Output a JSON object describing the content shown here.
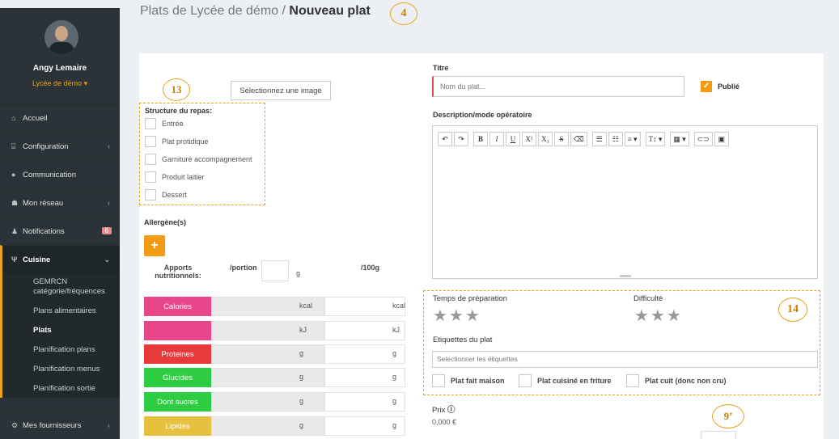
{
  "sidebar": {
    "user_name": "Angy Lemaire",
    "school": "Lycée de démo ▾",
    "items": [
      {
        "label": "Accueil",
        "icon": "home-icon",
        "glyph": "⌂"
      },
      {
        "label": "Configuration",
        "icon": "bank-icon",
        "glyph": "⌸",
        "chevron": "‹"
      },
      {
        "label": "Communication",
        "icon": "chat-icon",
        "glyph": "●"
      },
      {
        "label": "Mon réseau",
        "icon": "users-icon",
        "glyph": "☗",
        "chevron": "‹"
      },
      {
        "label": "Notifications",
        "icon": "bell-icon",
        "glyph": "♟",
        "badge": "6"
      },
      {
        "label": "Cuisine",
        "icon": "cutlery-icon",
        "glyph": "Ψ",
        "chevron": "⌄"
      }
    ],
    "sub_items": [
      "GEMRCN catégorie/fréquences",
      "Plans alimentaires",
      "Plats",
      "Planification plans",
      "Planification menus",
      "Planification sortie"
    ],
    "bottom_item": {
      "label": "Mes fournisseurs",
      "icon": "truck-icon",
      "glyph": "⚙",
      "chevron": "‹"
    }
  },
  "header": {
    "breadcrumb": "Plats de Lycée de démo / ",
    "title": "Nouveau plat"
  },
  "callouts": {
    "c4": "4",
    "c13": "13",
    "c14": "14",
    "c9": "9’"
  },
  "image_button": "Sélectionnez une image",
  "structure": {
    "title": "Structure du repas:",
    "options": [
      "Entrée",
      "Plat protidique",
      "Garniture accompagnement",
      "Produit laitier",
      "Dessert"
    ]
  },
  "allergens": {
    "label": "Allergène(s)",
    "add": "+"
  },
  "nutrition": {
    "head_apports": "Apports nutritionnels:",
    "head_portion": "/portion",
    "head_g": "g",
    "head_100g": "/100g",
    "rows": [
      {
        "name": "Calories",
        "unit": "kcal",
        "color": "#e8468a"
      },
      {
        "name": "",
        "unit": "kJ",
        "color": "#e8468a"
      },
      {
        "name": "Proteines",
        "unit": "g",
        "color": "#e83a3a"
      },
      {
        "name": "Glucides",
        "unit": "g",
        "color": "#2ecc40"
      },
      {
        "name": "Dont sucres",
        "unit": "g",
        "color": "#2ecc40"
      },
      {
        "name": "Lipides",
        "unit": "g",
        "color": "#e8c040"
      }
    ]
  },
  "form": {
    "titre_label": "Titre",
    "titre_placeholder": "Nom du plat...",
    "publie": "Publié",
    "description_label": "Description/mode opératoire",
    "toolbar": [
      "↶",
      "↷",
      "B",
      "I",
      "U",
      "X¹",
      "X₁",
      "S",
      "⌫",
      "☰",
      "☷",
      "≡ ▾",
      "T↕ ▾",
      "▦ ▾",
      "⊂⊃",
      "▣"
    ],
    "temps_label": "Temps de préparation",
    "difficulte_label": "Difficulté",
    "stars": "★★★",
    "etiquettes_label": "Etiquettes du plat",
    "etiquettes_placeholder": "Selectionner les étiquettes",
    "options": [
      "Plat fait maison",
      "Plat cuisiné en friture",
      "Plat cuit (donc non cru)"
    ],
    "prix_label": "Prix",
    "prix_info": "ⓘ",
    "prix_value": "0,000 €"
  }
}
